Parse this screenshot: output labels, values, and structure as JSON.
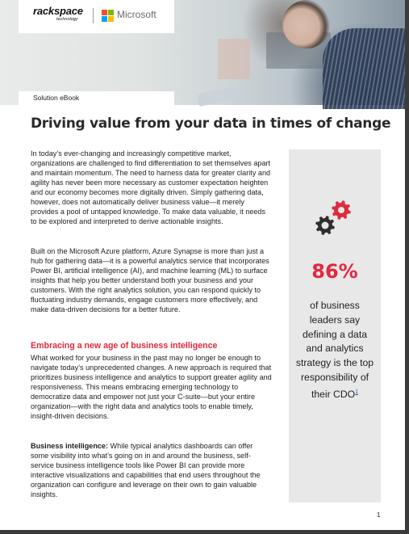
{
  "header": {
    "brand_primary": "rackspace",
    "brand_primary_sub": "technology",
    "brand_partner": "Microsoft",
    "ms_logo_colors": [
      "#f25022",
      "#7fba00",
      "#00a4ef",
      "#ffb900"
    ]
  },
  "document": {
    "type_label": "Solution eBook",
    "title": "Driving value from your data in times of change",
    "paragraphs": [
      "In today’s ever-changing and increasingly competitive market, organizations are challenged to find differentiation to set themselves apart and maintain momentum. The need to harness data for greater clarity and agility has never been more necessary as customer expectation heighten and our economy becomes more digitally driven. Simply gathering data, however, does not automatically deliver business value—it merely provides a pool of untapped knowledge. To make data valuable, it needs to be explored and interpreted to derive actionable insights.",
      "Built on the Microsoft Azure platform, Azure Synapse is more than just a hub for gathering data—it is a powerful analytics service that incorporates Power BI, artificial intelligence (AI), and machine learning (ML) to surface insights that help you better understand both your business and your customers. With the right analytics solution, you can respond quickly to fluctuating industry demands, engage customers more effectively, and make data-driven decisions for a better future."
    ],
    "section": {
      "heading": "Embracing a new age of business intelligence",
      "paragraph": "What worked for your business in the past may no longer be enough to navigate today’s unprecedented changes. A new approach is required that prioritizes business intelligence and analytics to support greater agility and responsiveness. This means embracing emerging technology to democratize data and empower not just your C-suite—but your entire organization—with the right data and analytics tools to enable timely, insight-driven decisions.",
      "bi_label": "Business intelligence:",
      "bi_text": " While typical analytics dashboards can offer some visibility into what’s going on in and around the business, self-service business intelligence tools like Power BI can provide more interactive visualizations and capabilities that end users throughout the organization can configure and leverage on their own to gain valuable insights."
    },
    "page_number": "1"
  },
  "sidebar": {
    "icon": "gears-icon",
    "stat_value": "86%",
    "stat_text": "of business leaders say defining a data and analytics strategy is the top responsibility of their CDO",
    "footnote": "1"
  },
  "colors": {
    "accent_red": "#e0293e",
    "panel_gray": "#e8e8e8",
    "gear_dark": "#2e2e2e"
  }
}
